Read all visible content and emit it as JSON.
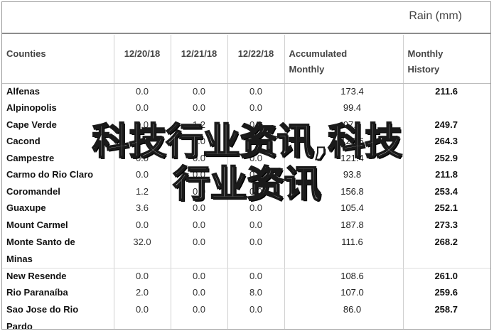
{
  "header": {
    "title": "Rain (mm)"
  },
  "columns": {
    "counties": "Counties",
    "d1": "12/20/18",
    "d2": "12/21/18",
    "d3": "12/22/18",
    "accum_line1": "Accumulated",
    "accum_line2": "Monthly",
    "hist_line1": "Monthly",
    "hist_line2": "History"
  },
  "rows": [
    {
      "county": "Alfenas",
      "d1": "0.0",
      "d2": "0.0",
      "d3": "0.0",
      "accum": "173.4",
      "hist": "211.6"
    },
    {
      "county": "Alpinopolis",
      "d1": "0.0",
      "d2": "0.0",
      "d3": "0.0",
      "accum": "99.4",
      "hist": ""
    },
    {
      "county": "Cape Verde",
      "d1": "0.0",
      "d2": "1.2",
      "d3": "0.0",
      "accum": "97.6",
      "hist": "249.7"
    },
    {
      "county": "Cacond",
      "d1": "1.2",
      "d2": "0.0",
      "d3": "0.0",
      "accum": "128.6",
      "hist": "264.3"
    },
    {
      "county": "Campestre",
      "d1": "0.0",
      "d2": "0.0",
      "d3": "0.0",
      "accum": "121.4",
      "hist": "252.9"
    },
    {
      "county": "Carmo do Rio Claro",
      "d1": "0.0",
      "d2": "0.0",
      "d3": "0.0",
      "accum": "93.8",
      "hist": "211.8"
    },
    {
      "county": "Coromandel",
      "d1": "1.2",
      "d2": "0.0",
      "d3": "0.0",
      "accum": "156.8",
      "hist": "253.4"
    },
    {
      "county": "Guaxupe",
      "d1": "3.6",
      "d2": "0.0",
      "d3": "0.0",
      "accum": "105.4",
      "hist": "252.1"
    },
    {
      "county": "Mount Carmel",
      "d1": "0.0",
      "d2": "0.0",
      "d3": "0.0",
      "accum": "187.8",
      "hist": "273.3"
    },
    {
      "county": "Monte Santo de",
      "county2": "Minas",
      "d1": "32.0",
      "d2": "0.0",
      "d3": "0.0",
      "accum": "111.6",
      "hist": "268.2"
    },
    {
      "county": "New Resende",
      "d1": "0.0",
      "d2": "0.0",
      "d3": "0.0",
      "accum": "108.6",
      "hist": "261.0"
    },
    {
      "county": "Rio Paranaíba",
      "d1": "2.0",
      "d2": "0.0",
      "d3": "8.0",
      "accum": "107.0",
      "hist": "259.6"
    },
    {
      "county": "Sao Jose do Rio",
      "county2": "Pardo",
      "d1": "0.0",
      "d2": "0.0",
      "d3": "0.0",
      "accum": "86.0",
      "hist": "258.7"
    }
  ],
  "watermark": {
    "line1": "科技行业资讯,科技",
    "line2": "行业资讯"
  }
}
